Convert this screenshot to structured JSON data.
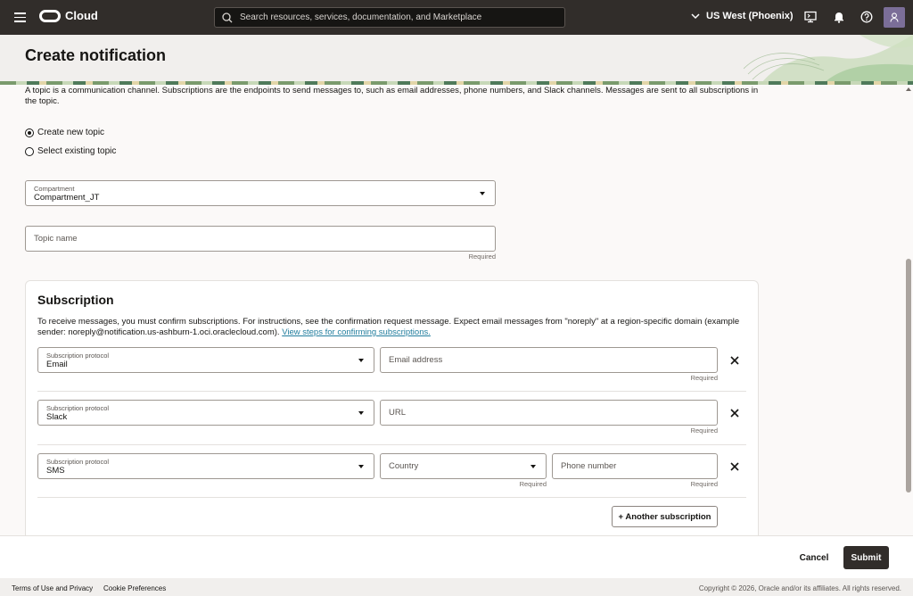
{
  "topbar": {
    "app_name": "Cloud",
    "search_placeholder": "Search resources, services, documentation, and Marketplace",
    "region": "US West (Phoenix)"
  },
  "page": {
    "title": "Create notification",
    "intro": "A topic is a communication channel. Subscriptions are the endpoints to send messages to, such as email addresses, phone numbers, and Slack channels. Messages are sent to all subscriptions in the topic."
  },
  "topic_mode": {
    "create_new": "Create new topic",
    "select_existing": "Select existing topic",
    "selected": "create_new"
  },
  "compartment": {
    "label": "Compartment",
    "value": "Compartment_JT"
  },
  "topic_name": {
    "placeholder": "Topic name",
    "required": "Required"
  },
  "subscription": {
    "title": "Subscription",
    "description": "To receive messages, you must confirm subscriptions. For instructions, see the confirmation request message. Expect email messages from \"noreply\" at a region-specific domain (example sender: noreply@notification.us-ashburn-1.oci.oraclecloud.com).",
    "link_text": "View steps for confirming subscriptions.",
    "protocol_label": "Subscription protocol",
    "required": "Required",
    "rows": [
      {
        "protocol": "Email",
        "field1": "Email address"
      },
      {
        "protocol": "Slack",
        "field1": "URL"
      },
      {
        "protocol": "SMS",
        "field1": "Country",
        "field2": "Phone number"
      }
    ],
    "add_button": "+ Another subscription"
  },
  "actions": {
    "cancel": "Cancel",
    "submit": "Submit"
  },
  "footer": {
    "terms": "Terms of Use and Privacy",
    "cookies": "Cookie Preferences",
    "copyright": "Copyright © 2026, Oracle and/or its affiliates. All rights reserved."
  }
}
